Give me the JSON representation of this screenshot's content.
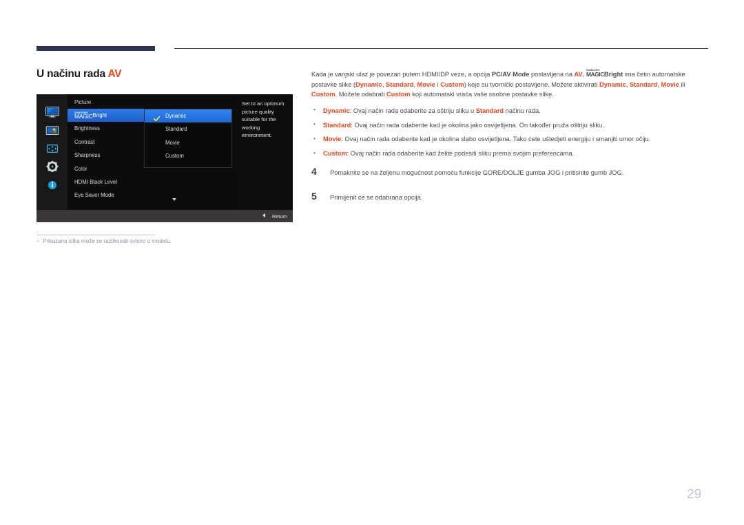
{
  "page": {
    "number": "29",
    "heading_prefix": "U načinu rada ",
    "heading_accent": "AV"
  },
  "osd": {
    "title": "Picture",
    "rail_icons": [
      {
        "name": "monitor-icon"
      },
      {
        "name": "picture-icon"
      },
      {
        "name": "position-arrows-icon"
      },
      {
        "name": "settings-gear-icon"
      },
      {
        "name": "information-icon"
      }
    ],
    "menu_items": [
      {
        "label": "Bright",
        "prefix_small": "SAMSUNG",
        "prefix_large": "MAGIC",
        "selected": true
      },
      {
        "label": "Brightness",
        "selected": false
      },
      {
        "label": "Contrast",
        "selected": false
      },
      {
        "label": "Sharpness",
        "selected": false
      },
      {
        "label": "Color",
        "selected": false
      },
      {
        "label": "HDMI Black Level",
        "selected": false
      },
      {
        "label": "Eye Saver Mode",
        "selected": false
      }
    ],
    "submenu_items": [
      {
        "label": "Dynamic",
        "selected": true
      },
      {
        "label": "Standard",
        "selected": false
      },
      {
        "label": "Movie",
        "selected": false
      },
      {
        "label": "Custom",
        "selected": false
      }
    ],
    "description": "Set to an optimum picture quality suitable for the working environment.",
    "return_label": "Return",
    "colors": {
      "highlight_blue": "#2c7ce8",
      "background": "#121212",
      "footer_gray": "#3b3739"
    }
  },
  "footnote": {
    "dash": "‒",
    "text": "Prikazana slika može se razlikovati ovisno o modelu."
  },
  "content": {
    "intro": {
      "seg1": "Kada je vanjski ulaz je povezan putem HDMI/DP veze, a opcija ",
      "bold_pcav": "PC/AV Mode",
      "seg2": " postavljena na ",
      "bold_av": "AV",
      "seg3": ", ",
      "magic_small": "SAMSUNG",
      "magic_large": "MAGIC",
      "magic_bright": "Bright",
      "seg4": " ima četiri automatske postavke slike (",
      "b_dynamic": "Dynamic",
      "sep1": ", ",
      "b_standard": "Standard",
      "sep2": ", ",
      "b_movie": "Movie",
      "sep3": " i ",
      "b_custom": "Custom",
      "seg5": ") koje su tvornički postavljene. Možete aktivirati ",
      "b_dynamic2": "Dynamic",
      "sep4": ", ",
      "b_standard2": "Standard",
      "sep5": ", ",
      "b_movie2": "Movie",
      "sep6": " ili ",
      "b_custom2": "Custom",
      "seg6": ". Možete odabrati ",
      "b_custom3": "Custom",
      "seg7": " koji automatski vraća vaše osobne postavke slike."
    },
    "bullets": [
      {
        "term": "Dynamic",
        "text_a": ": Ovaj način rada odaberite za oštriju sliku u ",
        "term2": "Standard",
        "text_b": " načinu rada."
      },
      {
        "term": "Standard",
        "text_a": ": Ovaj način rada odaberite kad je okolina jako osvijetljena. On također pruža oštriju sliku.",
        "term2": "",
        "text_b": ""
      },
      {
        "term": "Movie",
        "text_a": ": Ovaj način rada odaberite kad je okolina slabo osvijetljena. Tako ćete uštedjeti energiju i smanjiti umor očiju.",
        "term2": "",
        "text_b": ""
      },
      {
        "term": "Custom",
        "text_a": ": Ovaj način rada odaberite kad želite podesiti sliku prema svojim preferencama.",
        "term2": "",
        "text_b": ""
      }
    ],
    "steps": [
      {
        "number": "4",
        "text": "Pomaknite se na željenu mogućnost pomoću funkcije GORE/DOLJE gumba JOG i pritisnite gumb JOG."
      },
      {
        "number": "5",
        "text": "Primijenit će se odabrana opcija."
      }
    ]
  }
}
